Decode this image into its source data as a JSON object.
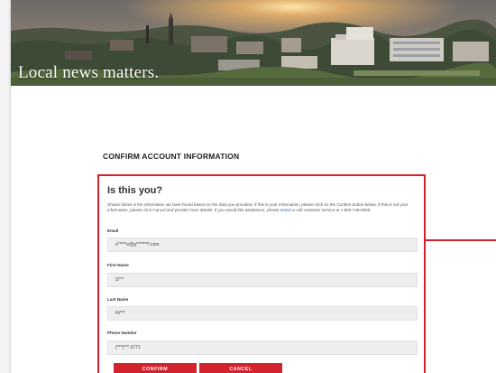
{
  "hero": {
    "tagline": "Local news matters."
  },
  "section_title": "CONFIRM ACCOUNT INFORMATION",
  "card": {
    "title": "Is this you?",
    "description_before_link": "Shown below is the information we have found based on the data you provided. If this is your information, please click on the Confirm button below. If this is not your information, please click Cancel and provide more details. If you would like assistance, please ",
    "description_link": "email",
    "description_after_link": " or call customer service at 1-800-745-6650.",
    "fields": [
      {
        "label": "Email",
        "value": "s*****e@g*******l.com"
      },
      {
        "label": "First Name",
        "value": "S***"
      },
      {
        "label": "Last Name",
        "value": "Hi***"
      },
      {
        "label": "Phone Number",
        "value": "(***)***-3771"
      }
    ],
    "confirm_label": "CONFIRM",
    "cancel_label": "CANCEL"
  },
  "colors": {
    "accent": "#d2222d",
    "field_bg": "#eeeeee"
  }
}
